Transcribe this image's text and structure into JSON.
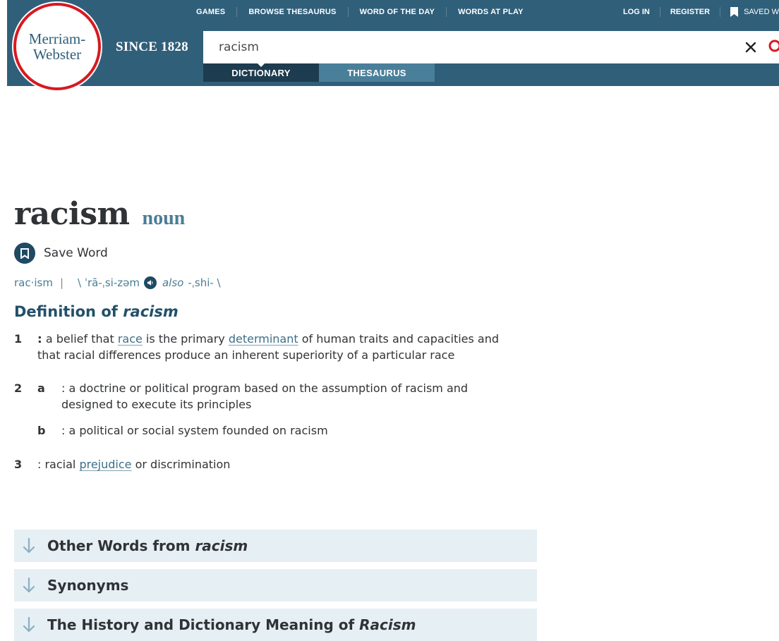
{
  "header": {
    "logo_line1": "Merriam-",
    "logo_line2": "Webster",
    "since": "SINCE 1828",
    "nav": [
      "GAMES",
      "BROWSE THESAURUS",
      "WORD OF THE DAY",
      "WORDS AT PLAY"
    ],
    "auth": {
      "login": "LOG IN",
      "register": "REGISTER",
      "saved": "SAVED W"
    },
    "search": {
      "value": "racism"
    },
    "tabs": {
      "dictionary": "DICTIONARY",
      "thesaurus": "THESAURUS"
    }
  },
  "entry": {
    "headword": "racism",
    "part_of_speech": "noun",
    "save_word": "Save Word",
    "syllables": "rac·ism",
    "separator": "|",
    "pronunciation": "\\ ˈrā-ˌsi-zəm",
    "also": "also",
    "also_pron": "-ˌshi- \\",
    "definition_heading_prefix": "Definition of ",
    "definition_heading_word": "racism"
  },
  "senses": {
    "s1": {
      "num": "1",
      "line1_a": ": a belief that ",
      "line1_link1": "race",
      "line1_b": " is the primary ",
      "line1_link2": "determinant",
      "line1_c": " of human traits and capacities and",
      "line2": "that racial differences produce an inherent superiority of a particular race"
    },
    "s2a": {
      "num": "2",
      "letter": "a",
      "line1": ": a doctrine or political program based on the assumption of racism and",
      "line2": "designed to execute its principles"
    },
    "s2b": {
      "letter": "b",
      "line1": ": a political or social system founded on racism"
    },
    "s3": {
      "num": "3",
      "line1_a": ": racial ",
      "line1_link": "prejudice",
      "line1_b": " or discrimination"
    }
  },
  "accordions": {
    "other_words_prefix": "Other Words from ",
    "other_words_word": "racism",
    "synonyms": "Synonyms",
    "history_prefix": "The History and Dictionary Meaning of ",
    "history_word": "Racism"
  },
  "colors": {
    "header_bg": "#305f7a",
    "logo_ring": "#d71920",
    "link": "#3d6f87",
    "accordion_bg": "#e6eff4"
  }
}
